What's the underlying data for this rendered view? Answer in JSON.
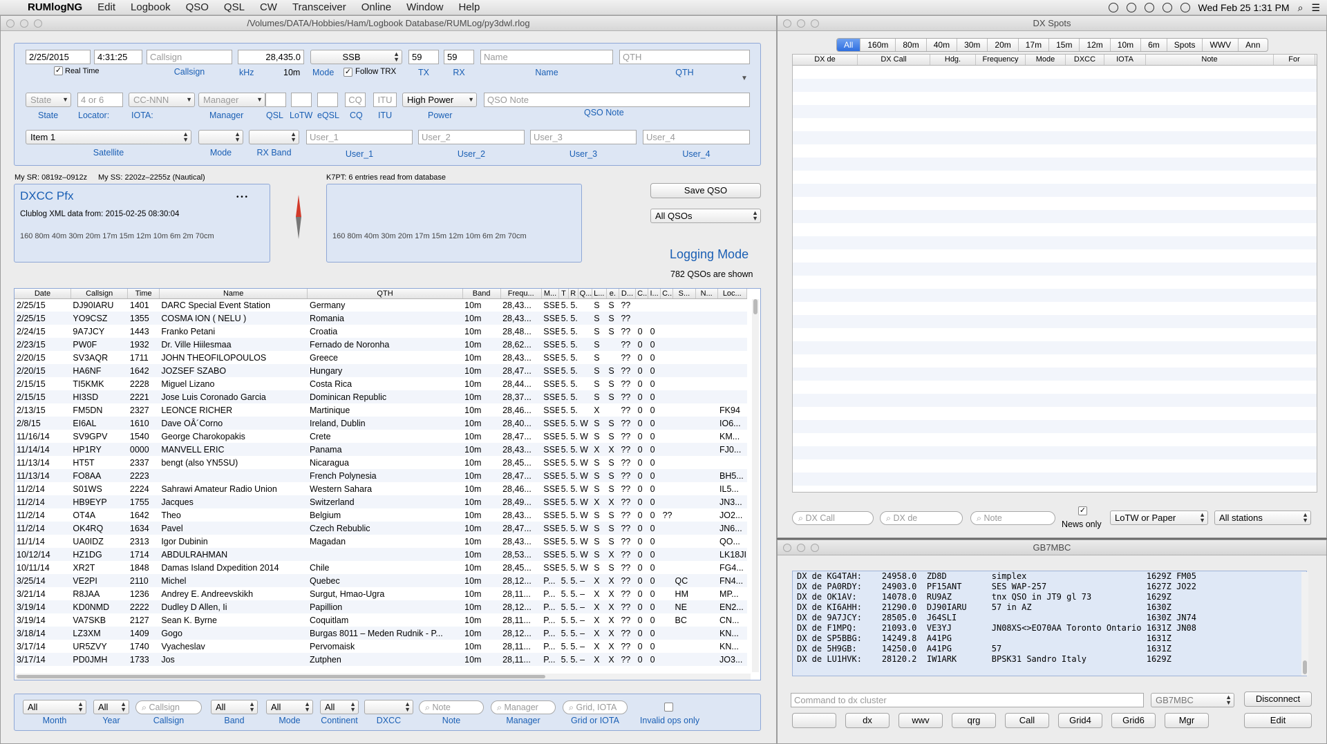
{
  "menubar": {
    "apple": "",
    "app": "RUMlogNG",
    "items": [
      "Edit",
      "Logbook",
      "QSO",
      "QSL",
      "CW",
      "Transceiver",
      "Online",
      "Window",
      "Help"
    ],
    "clock": "Wed Feb 25  1:31 PM"
  },
  "main_window": {
    "title": "/Volumes/DATA/Hobbies/Ham/Logbook Database/RUMLog/py3dwl.rlog"
  },
  "entry": {
    "date": "2/25/2015",
    "time": "4:31:25",
    "callsign_placeholder": "Callsign",
    "frequency": "28,435.0",
    "mode": "SSB",
    "tx": "59",
    "rx": "59",
    "name_placeholder": "Name",
    "qth_placeholder": "QTH",
    "real_time_label": "Real Time",
    "follow_trx_label": "Follow TRX",
    "band": "10m",
    "labels": {
      "callsign": "Callsign",
      "khz": "kHz",
      "mode": "Mode",
      "tx": "TX",
      "rx": "RX",
      "name": "Name",
      "qth": "QTH",
      "state": "State",
      "locator": "Locator:",
      "iota": "IOTA:",
      "manager": "Manager",
      "qsl": "QSL",
      "lotw": "LoTW",
      "eqsl": "eQSL",
      "cq": "CQ",
      "itu": "ITU",
      "power": "Power",
      "qso_note": "QSO Note",
      "satellite": "Satellite",
      "sat_mode": "Mode",
      "rx_band": "RX Band",
      "user_1": "User_1",
      "user_2": "User_2",
      "user_3": "User_3",
      "user_4": "User_4"
    },
    "state_placeholder": "State",
    "locator_placeholder": "4 or 6",
    "iota_placeholder": "CC-NNN",
    "manager_placeholder": "Manager",
    "cq_placeholder": "CQ",
    "itu_placeholder": "ITU",
    "power": "High Power",
    "qso_note_placeholder": "QSO Note",
    "satellite": "Item 1",
    "user_1_placeholder": "User_1",
    "user_2_placeholder": "User_2",
    "user_3_placeholder": "User_3",
    "user_4_placeholder": "User_4"
  },
  "sun": {
    "sr": "My SR: 0819z–0912z",
    "ss": "My SS: 2202z–2255z (Nautical)"
  },
  "dxcc": {
    "title": "DXCC Pfx",
    "clublog": "Clublog XML data from: 2015-02-25 08:30:04",
    "bands": "160  80m  40m  30m  20m  17m  15m  12m  10m   6m   2m  70cm",
    "more": "• • •"
  },
  "db_box": {
    "header": "K7PT: 6 entries read from database",
    "bands": "160  80m  40m  30m  20m  17m  15m  12m  10m   6m   2m  70cm"
  },
  "actions": {
    "save_qso": "Save QSO",
    "filter": "All QSOs",
    "logging_mode": "Logging Mode",
    "count": "782 QSOs are shown"
  },
  "table": {
    "headers": [
      "Date",
      "Callsign",
      "Time",
      "Name",
      "QTH",
      "Band",
      "Frequ...",
      "M...",
      "T",
      "R",
      "Q...",
      "L...",
      "e.",
      "D...",
      "C..",
      "I...",
      "C..",
      "S...",
      "N...",
      "Loc..."
    ],
    "rows": [
      [
        "2/25/15",
        "DJ90IARU",
        "1401",
        "DARC Special Event Station",
        "Germany",
        "10m",
        "28,43...",
        "SSB",
        "5.",
        "5.",
        "",
        "S",
        "S",
        "??",
        "",
        "",
        "",
        "",
        "",
        ""
      ],
      [
        "2/25/15",
        "YO9CSZ",
        "1355",
        "COSMA ION ( NELU )",
        "Romania",
        "10m",
        "28,43...",
        "SSB",
        "5.",
        "5.",
        "",
        "S",
        "S",
        "??",
        "",
        "",
        "",
        "",
        "",
        ""
      ],
      [
        "2/24/15",
        "9A7JCY",
        "1443",
        "Franko Petani",
        "Croatia",
        "10m",
        "28,48...",
        "SSB",
        "5.",
        "5.",
        "",
        "S",
        "S",
        "??",
        "0",
        "0",
        "",
        "",
        "",
        ""
      ],
      [
        "2/23/15",
        "PW0F",
        "1932",
        "Dr. Ville Hiilesmaa",
        "Fernado de Noronha",
        "10m",
        "28,62...",
        "SSB",
        "5.",
        "5.",
        "",
        "S",
        "",
        "??",
        "0",
        "0",
        "",
        "",
        "",
        ""
      ],
      [
        "2/20/15",
        "SV3AQR",
        "1711",
        "JOHN THEOFILOPOULOS",
        "Greece",
        "10m",
        "28,43...",
        "SSB",
        "5.",
        "5.",
        "",
        "S",
        "",
        "??",
        "0",
        "0",
        "",
        "",
        "",
        ""
      ],
      [
        "2/20/15",
        "HA6NF",
        "1642",
        "JOZSEF SZABO",
        "Hungary",
        "10m",
        "28,47...",
        "SSB",
        "5.",
        "5.",
        "",
        "S",
        "S",
        "??",
        "0",
        "0",
        "",
        "",
        "",
        ""
      ],
      [
        "2/15/15",
        "TI5KMK",
        "2228",
        "Miguel Lizano",
        "Costa Rica",
        "10m",
        "28,44...",
        "SSB",
        "5.",
        "5.",
        "",
        "S",
        "S",
        "??",
        "0",
        "0",
        "",
        "",
        "",
        ""
      ],
      [
        "2/15/15",
        "HI3SD",
        "2221",
        "Jose Luis Coronado Garcia",
        "Dominican Republic",
        "10m",
        "28,37...",
        "SSB",
        "5.",
        "5.",
        "",
        "S",
        "S",
        "??",
        "0",
        "0",
        "",
        "",
        "",
        ""
      ],
      [
        "2/13/15",
        "FM5DN",
        "2327",
        "LEONCE RICHER",
        "Martinique",
        "10m",
        "28,46...",
        "SSB",
        "5.",
        "5.",
        "",
        "X",
        "",
        "??",
        "0",
        "0",
        "",
        "",
        "",
        "FK94"
      ],
      [
        "2/8/15",
        "EI6AL",
        "1610",
        "Dave OÂ´Corno",
        "Ireland, Dublin",
        "10m",
        "28,40...",
        "SSB",
        "5.",
        "5.",
        "W",
        "S",
        "S",
        "??",
        "0",
        "0",
        "",
        "",
        "",
        "IO6..."
      ],
      [
        "11/16/14",
        "SV9GPV",
        "1540",
        "George Charokopakis",
        "Crete",
        "10m",
        "28,47...",
        "SSB",
        "5.",
        "5.",
        "W",
        "S",
        "S",
        "??",
        "0",
        "0",
        "",
        "",
        "",
        "KM..."
      ],
      [
        "11/14/14",
        "HP1RY",
        "0000",
        "MANVELL ERIC",
        "Panama",
        "10m",
        "28,43...",
        "SSB",
        "5.",
        "5.",
        "W",
        "X",
        "X",
        "??",
        "0",
        "0",
        "",
        "",
        "",
        "FJ0..."
      ],
      [
        "11/13/14",
        "HT5T",
        "2337",
        "bengt (also YN5SU)",
        "Nicaragua",
        "10m",
        "28,45...",
        "SSB",
        "5.",
        "5.",
        "W",
        "S",
        "S",
        "??",
        "0",
        "0",
        "",
        "",
        "",
        ""
      ],
      [
        "11/13/14",
        "FO8AA",
        "2223",
        "",
        "French Polynesia",
        "10m",
        "28,47...",
        "SSB",
        "5.",
        "5.",
        "W",
        "S",
        "S",
        "??",
        "0",
        "0",
        "",
        "",
        "",
        "BH5..."
      ],
      [
        "11/2/14",
        "S01WS",
        "2224",
        "Sahrawi Amateur Radio Union",
        "Western Sahara",
        "10m",
        "28,46...",
        "SSB",
        "5.",
        "5.",
        "W",
        "S",
        "S",
        "??",
        "0",
        "0",
        "",
        "",
        "",
        "IL5..."
      ],
      [
        "11/2/14",
        "HB9EYP",
        "1755",
        "Jacques",
        "Switzerland",
        "10m",
        "28,49...",
        "SSB",
        "5.",
        "5.",
        "W",
        "X",
        "X",
        "??",
        "0",
        "0",
        "",
        "",
        "",
        "JN3..."
      ],
      [
        "11/2/14",
        "OT4A",
        "1642",
        "Theo",
        "Belgium",
        "10m",
        "28,43...",
        "SSB",
        "5.",
        "5.",
        "W",
        "S",
        "S",
        "??",
        "0",
        "0",
        "??",
        "",
        "",
        "JO2..."
      ],
      [
        "11/2/14",
        "OK4RQ",
        "1634",
        "Pavel",
        "Czech Rebublic",
        "10m",
        "28,47...",
        "SSB",
        "5.",
        "5.",
        "W",
        "S",
        "S",
        "??",
        "0",
        "0",
        "",
        "",
        "",
        "JN6..."
      ],
      [
        "11/1/14",
        "UA0IDZ",
        "2313",
        "Igor Dubinin",
        "Magadan",
        "10m",
        "28,43...",
        "SSB",
        "5.",
        "5.",
        "W",
        "S",
        "S",
        "??",
        "0",
        "0",
        "",
        "",
        "",
        "QO..."
      ],
      [
        "10/12/14",
        "HZ1DG",
        "1714",
        "ABDULRAHMAN",
        "",
        "10m",
        "28,53...",
        "SSB",
        "5.",
        "5.",
        "W",
        "S",
        "X",
        "??",
        "0",
        "0",
        "",
        "",
        "",
        "LK18JI"
      ],
      [
        "10/11/14",
        "XR2T",
        "1848",
        "Damas Island Dxpedition 2014",
        "Chile",
        "10m",
        "28,45...",
        "SSB",
        "5.",
        "5.",
        "W",
        "S",
        "S",
        "??",
        "0",
        "0",
        "",
        "",
        "",
        "FG4..."
      ],
      [
        "3/25/14",
        "VE2PI",
        "2110",
        "Michel",
        "Quebec",
        "10m",
        "28,12...",
        "P...",
        "5.",
        "5.",
        "–",
        "X",
        "X",
        "??",
        "0",
        "0",
        "",
        "QC",
        "",
        "FN4..."
      ],
      [
        "3/21/14",
        "R8JAA",
        "1236",
        "Andrey E. Andreevskikh",
        "Surgut, Hmao-Ugra",
        "10m",
        "28,11...",
        "P...",
        "5.",
        "5.",
        "–",
        "X",
        "X",
        "??",
        "0",
        "0",
        "",
        "HM",
        "",
        "MP..."
      ],
      [
        "3/19/14",
        "KD0NMD",
        "2222",
        "Dudley D Allen, Ii",
        "Papillion",
        "10m",
        "28,12...",
        "P...",
        "5.",
        "5.",
        "–",
        "X",
        "X",
        "??",
        "0",
        "0",
        "",
        "NE",
        "",
        "EN2..."
      ],
      [
        "3/19/14",
        "VA7SKB",
        "2127",
        "Sean K. Byrne",
        "Coquitlam",
        "10m",
        "28,11...",
        "P...",
        "5.",
        "5.",
        "–",
        "X",
        "X",
        "??",
        "0",
        "0",
        "",
        "BC",
        "",
        "CN..."
      ],
      [
        "3/18/14",
        "LZ3XM",
        "1409",
        "Gogo",
        "Burgas 8011 – Meden Rudnik - P...",
        "10m",
        "28,12...",
        "P...",
        "5.",
        "5.",
        "–",
        "X",
        "X",
        "??",
        "0",
        "0",
        "",
        "",
        "",
        "KN..."
      ],
      [
        "3/17/14",
        "UR5ZVY",
        "1740",
        "Vyacheslav",
        "Pervomaisk",
        "10m",
        "28,11...",
        "P...",
        "5.",
        "5.",
        "–",
        "X",
        "X",
        "??",
        "0",
        "0",
        "",
        "",
        "",
        "KN..."
      ],
      [
        "3/17/14",
        "PD0JMH",
        "1733",
        "Jos",
        "Zutphen",
        "10m",
        "28,11...",
        "P...",
        "5.",
        "5.",
        "–",
        "X",
        "X",
        "??",
        "0",
        "0",
        "",
        "",
        "",
        "JO3..."
      ]
    ]
  },
  "filters": {
    "month": "All",
    "year": "All",
    "callsign_placeholder": "Callsign",
    "band": "All",
    "mode": "All",
    "continent": "All",
    "dxcc": "",
    "note_placeholder": "Note",
    "manager_placeholder": "Manager",
    "grid_placeholder": "Grid, IOTA",
    "labels": {
      "month": "Month",
      "year": "Year",
      "callsign": "Callsign",
      "band": "Band",
      "mode": "Mode",
      "continent": "Continent",
      "dxcc": "DXCC",
      "note": "Note",
      "manager": "Manager",
      "grid": "Grid or IOTA",
      "invalid": "Invalid ops only"
    }
  },
  "dx_spots": {
    "title": "DX Spots",
    "tabs": [
      "All",
      "160m",
      "80m",
      "40m",
      "30m",
      "20m",
      "17m",
      "15m",
      "12m",
      "10m",
      "6m",
      "Spots",
      "WWV",
      "Ann"
    ],
    "columns": [
      "DX de",
      "DX Call",
      "Hdg.",
      "Frequency",
      "Mode",
      "DXCC",
      "IOTA",
      "Note",
      "For"
    ],
    "search_call": "DX Call",
    "search_de": "DX de",
    "search_note": "Note",
    "news_only": "News only",
    "lotw_filter": "LoTW or Paper",
    "stations_filter": "All stations"
  },
  "cluster": {
    "title": "GB7MBC",
    "lines": [
      "DX de KG4TAH:    24958.0  ZD8D         simplex                        1629Z FM05",
      "DX de PA0RDY:    24903.0  PF15ANT      SES WAP-257                    1627Z JO22",
      "DX de OK1AV:     14078.0  RU9AZ        tnx QSO in JT9 gl 73           1629Z",
      "DX de KI6AHH:    21290.0  DJ90IARU     57 in AZ                       1630Z",
      "DX de 9A7JCY:    28505.0  J64SLI                                      1630Z JN74",
      "DX de F1MPQ:     21093.0  VE3YJ        JN08XS<>EO70AA Toronto Ontario 1631Z JN08",
      "DX de SP5BBG:    14249.8  A41PG                                       1631Z",
      "DX de 5H9GB:     14250.0  A41PG        57                             1631Z",
      "DX de LU1HVK:    28120.2  IW1ARK       BPSK31 Sandro Italy            1629Z"
    ],
    "command_placeholder": "Command to dx cluster",
    "node": "GB7MBC",
    "disconnect": "Disconnect",
    "buttons": [
      "",
      "dx",
      "wwv",
      "qrg",
      "Call",
      "Grid4",
      "Grid6",
      "Mgr"
    ],
    "edit": "Edit"
  }
}
